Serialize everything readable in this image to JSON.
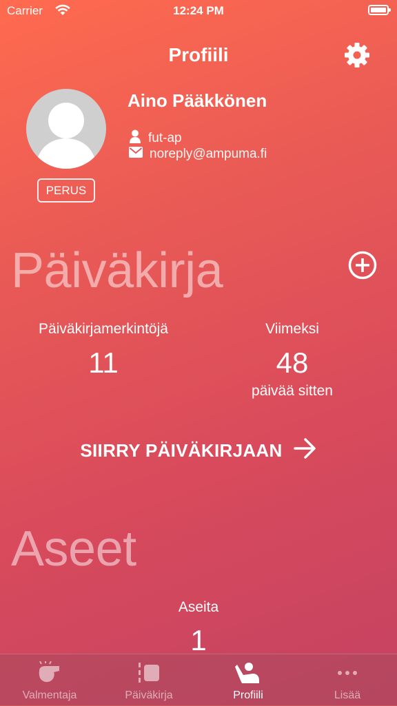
{
  "status_bar": {
    "carrier": "Carrier",
    "time": "12:24 PM"
  },
  "nav": {
    "title": "Profiili",
    "settings_icon": "gear-icon"
  },
  "profile": {
    "name": "Aino Pääkkönen",
    "username": "fut-ap",
    "email": "noreply@ampuma.fi",
    "badge": "PERUS"
  },
  "diary": {
    "heading": "Päiväkirja",
    "entries_label": "Päiväkirjamerkintöjä",
    "entries_value": "11",
    "last_label": "Viimeksi",
    "last_value": "48",
    "last_unit": "päivää sitten",
    "goto_label": "SIIRRY PÄIVÄKIRJAAN"
  },
  "weapons": {
    "heading": "Aseet",
    "count_label": "Aseita",
    "count_value": "1"
  },
  "tabbar": {
    "items": [
      {
        "label": "Valmentaja",
        "icon": "whistle-icon",
        "active": false
      },
      {
        "label": "Päiväkirja",
        "icon": "diary-icon",
        "active": false
      },
      {
        "label": "Profiili",
        "icon": "profile-icon",
        "active": true
      },
      {
        "label": "Lisää",
        "icon": "more-icon",
        "active": false
      }
    ]
  }
}
